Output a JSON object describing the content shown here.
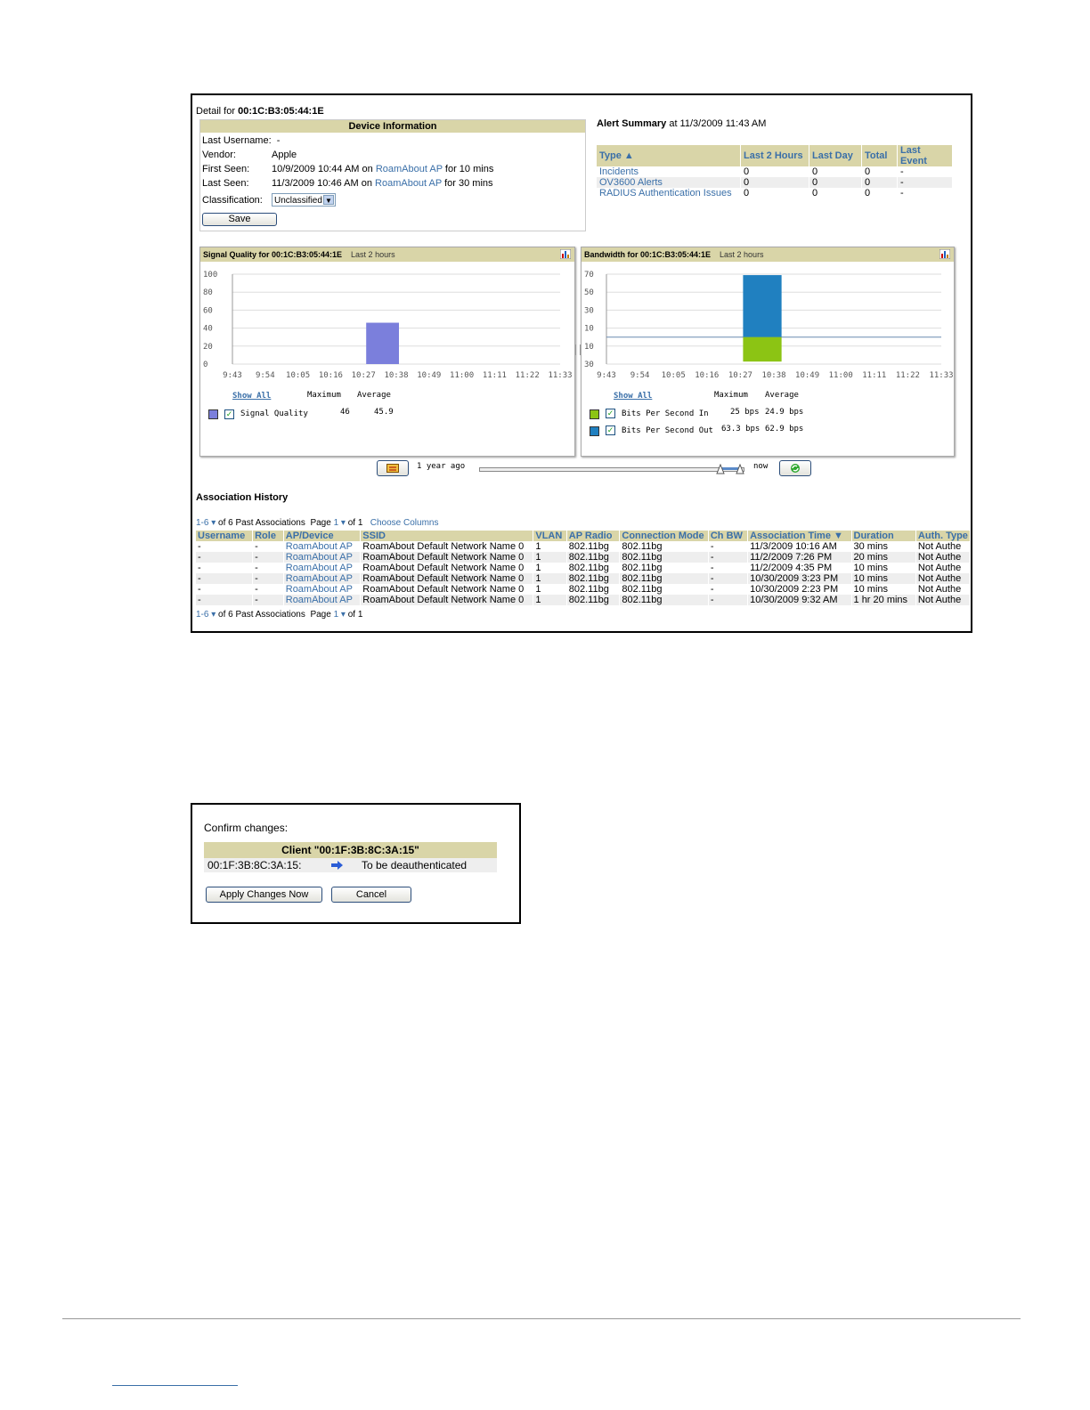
{
  "detail": {
    "prefix": "Detail for ",
    "mac": "00:1C:B3:05:44:1E"
  },
  "device_info": {
    "title": "Device Information",
    "last_username_label": "Last Username:",
    "last_username_value": "-",
    "vendor_label": "Vendor:",
    "vendor_value": "Apple",
    "first_seen_label": "First Seen:",
    "first_seen_time": "10/9/2009 10:44 AM on",
    "first_seen_ap": "RoamAbout AP",
    "first_seen_dur": "for 10 mins",
    "last_seen_label": "Last Seen:",
    "last_seen_time": "11/3/2009 10:46 AM on",
    "last_seen_ap": "RoamAbout AP",
    "last_seen_dur": "for 30 mins",
    "classification_label": "Classification:",
    "classification_value": "Unclassified",
    "save_label": "Save"
  },
  "alert_summary": {
    "title": "Alert Summary",
    "at": "at 11/3/2009 11:43 AM",
    "columns": [
      "Type ▲",
      "Last 2 Hours",
      "Last Day",
      "Total",
      "Last Event"
    ],
    "rows": [
      [
        "Incidents",
        "0",
        "0",
        "0",
        "-"
      ],
      [
        "OV3600 Alerts",
        "0",
        "0",
        "0",
        "-"
      ],
      [
        "RADIUS Authentication Issues",
        "0",
        "0",
        "0",
        "-"
      ]
    ]
  },
  "signal_chart": {
    "title": "Signal Quality for 00:1C:B3:05:44:1E",
    "range": "Last 2 hours",
    "show_all": "Show All",
    "max_label": "Maximum",
    "avg_label": "Average",
    "series_name": "Signal Quality",
    "series_max": "46",
    "series_avg": "45.9",
    "color": "#7b7fdc"
  },
  "bandwidth_chart": {
    "title": "Bandwidth for 00:1C:B3:05:44:1E",
    "range": "Last 2 hours",
    "show_all": "Show All",
    "max_label": "Maximum",
    "avg_label": "Average",
    "in_name": "Bits Per Second In",
    "in_max": "25 bps",
    "in_avg": "24.9 bps",
    "in_color": "#8cc414",
    "out_name": "Bits Per Second Out",
    "out_max": "63.3 bps",
    "out_avg": "62.9 bps",
    "out_color": "#2080c0"
  },
  "chart_data": [
    {
      "type": "bar",
      "title": "Signal Quality for 00:1C:B3:05:44:1E",
      "categories": [
        "9:43",
        "9:54",
        "10:05",
        "10:16",
        "10:27",
        "10:38",
        "10:49",
        "11:00",
        "11:11",
        "11:22",
        "11:33"
      ],
      "y_ticks": [
        "100",
        "80",
        "60",
        "40",
        "20",
        "0"
      ],
      "ylim": [
        0,
        100
      ],
      "bars": [
        {
          "x_from": "10:27",
          "x_to": "10:38",
          "value": 46
        }
      ],
      "series": [
        {
          "name": "Signal Quality",
          "values": [
            46
          ]
        }
      ]
    },
    {
      "type": "bar",
      "title": "Bandwidth for 00:1C:B3:05:44:1E",
      "categories": [
        "9:43",
        "9:54",
        "10:05",
        "10:16",
        "10:27",
        "10:38",
        "10:49",
        "11:00",
        "11:11",
        "11:22",
        "11:33"
      ],
      "y_ticks": [
        "70",
        "50",
        "30",
        "10",
        "10",
        "30"
      ],
      "series": [
        {
          "name": "Bits Per Second Out",
          "values": [
            63.3
          ]
        },
        {
          "name": "Bits Per Second In",
          "values": [
            25
          ]
        }
      ]
    }
  ],
  "slider": {
    "left_label": "1 year ago",
    "right_label": "now"
  },
  "association": {
    "title": "Association History",
    "pager_range": "1-6",
    "pager_of": "of 6 Past Associations",
    "pager_page": "Page",
    "pager_page_num": "1",
    "pager_of_pages": "of 1",
    "choose_columns": "Choose Columns",
    "columns": [
      "Username",
      "Role",
      "AP/Device",
      "SSID",
      "VLAN",
      "AP Radio",
      "Connection Mode",
      "Ch BW",
      "Association Time ▼",
      "Duration",
      "Auth. Type"
    ],
    "rows": [
      [
        "-",
        "-",
        "RoamAbout AP",
        "RoamAbout Default Network Name 0",
        "1",
        "802.11bg",
        "802.11bg",
        "-",
        "11/3/2009 10:16 AM",
        "30 mins",
        "Not Authe"
      ],
      [
        "-",
        "-",
        "RoamAbout AP",
        "RoamAbout Default Network Name 0",
        "1",
        "802.11bg",
        "802.11bg",
        "-",
        "11/2/2009 7:26 PM",
        "20 mins",
        "Not Authe"
      ],
      [
        "-",
        "-",
        "RoamAbout AP",
        "RoamAbout Default Network Name 0",
        "1",
        "802.11bg",
        "802.11bg",
        "-",
        "11/2/2009 4:35 PM",
        "10 mins",
        "Not Authe"
      ],
      [
        "-",
        "-",
        "RoamAbout AP",
        "RoamAbout Default Network Name 0",
        "1",
        "802.11bg",
        "802.11bg",
        "-",
        "10/30/2009 3:23 PM",
        "10 mins",
        "Not Authe"
      ],
      [
        "-",
        "-",
        "RoamAbout AP",
        "RoamAbout Default Network Name 0",
        "1",
        "802.11bg",
        "802.11bg",
        "-",
        "10/30/2009 2:23 PM",
        "10 mins",
        "Not Authe"
      ],
      [
        "-",
        "-",
        "RoamAbout AP",
        "RoamAbout Default Network Name 0",
        "1",
        "802.11bg",
        "802.11bg",
        "-",
        "10/30/2009 9:32 AM",
        "1 hr 20 mins",
        "Not Authe"
      ]
    ]
  },
  "confirm": {
    "title": "Confirm changes:",
    "header": "Client \"00:1F:3B:8C:3A:15\"",
    "mac": "00:1F:3B:8C:3A:15:",
    "action": "To be deauthenticated",
    "apply_label": "Apply Changes Now",
    "cancel_label": "Cancel"
  }
}
